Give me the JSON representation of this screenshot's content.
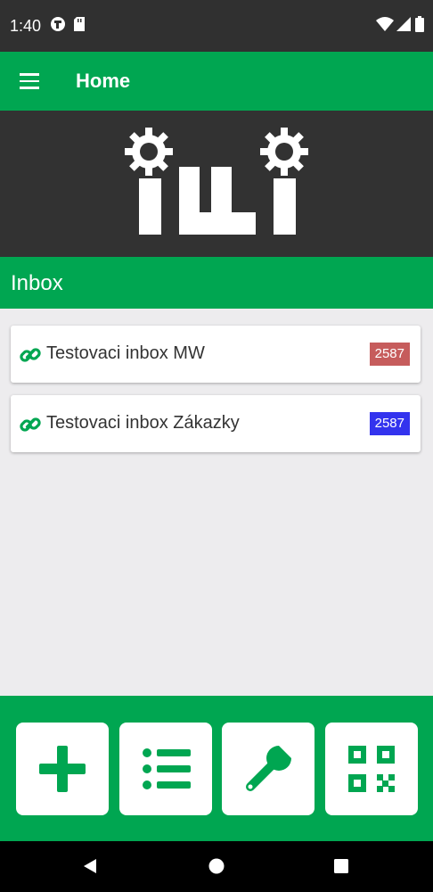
{
  "status_bar": {
    "time": "1:40",
    "icons": [
      "app-notification-icon",
      "sd-card-icon",
      "wifi-icon",
      "signal-icon",
      "battery-icon"
    ]
  },
  "app_bar": {
    "title": "Home",
    "menu_icon": "hamburger-menu-icon"
  },
  "banner": {
    "logo": "iwi-gears-logo"
  },
  "inbox_section": {
    "title": "Inbox",
    "items": [
      {
        "name": "Testovaci inbox MW",
        "count": "2587",
        "badge_color": "#c65c5c",
        "icon": "link-icon"
      },
      {
        "name": "Testovaci inbox Zákazky",
        "count": "2587",
        "badge_color": "#3333ee",
        "icon": "link-icon"
      }
    ]
  },
  "toolbar": {
    "buttons": [
      {
        "icon": "plus-icon"
      },
      {
        "icon": "list-icon"
      },
      {
        "icon": "wrench-icon"
      },
      {
        "icon": "qr-code-icon"
      }
    ]
  },
  "colors": {
    "accent": "#00a651",
    "dark": "#323232",
    "background": "#edecee"
  }
}
